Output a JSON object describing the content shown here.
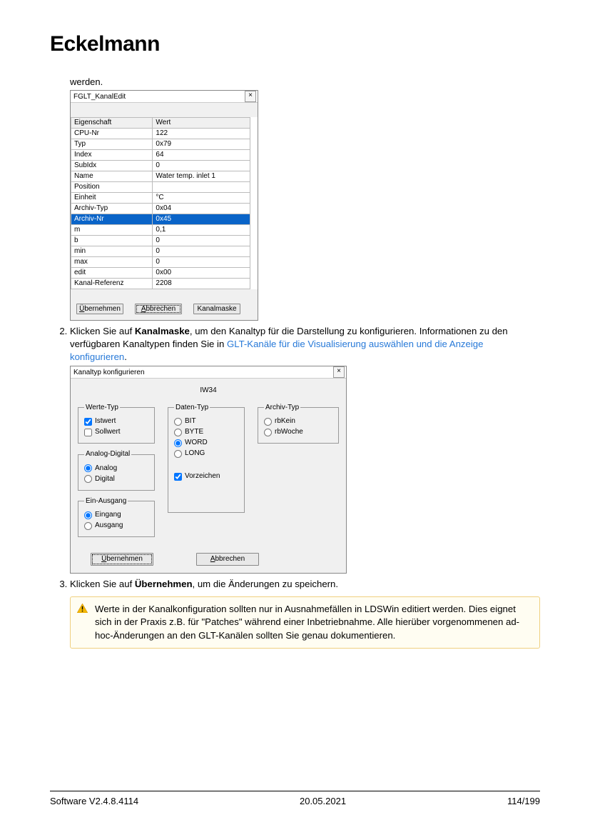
{
  "brand": "Eckelmann",
  "fragment": "werden.",
  "dialog1": {
    "title": "FGLT_KanalEdit",
    "head": {
      "k": "Eigenschaft",
      "v": "Wert"
    },
    "rows": [
      {
        "k": "CPU-Nr",
        "v": "122"
      },
      {
        "k": "Typ",
        "v": "0x79"
      },
      {
        "k": "Index",
        "v": "64"
      },
      {
        "k": "SubIdx",
        "v": "0"
      },
      {
        "k": "Name",
        "v": "Water temp. inlet 1"
      },
      {
        "k": "Position",
        "v": ""
      },
      {
        "k": "Einheit",
        "v": "°C"
      },
      {
        "k": "Archiv-Typ",
        "v": "0x04"
      },
      {
        "k": "Archiv-Nr",
        "v": "0x45"
      },
      {
        "k": "m",
        "v": "0,1"
      },
      {
        "k": "b",
        "v": "0"
      },
      {
        "k": "min",
        "v": "0"
      },
      {
        "k": "max",
        "v": "0"
      },
      {
        "k": "edit",
        "v": "0x00"
      },
      {
        "k": "Kanal-Referenz",
        "v": "2208"
      }
    ],
    "selected_index": 8,
    "btn_apply": "Übernehmen",
    "btn_cancel": "Abbrechen",
    "btn_mask": "Kanalmaske"
  },
  "step2": {
    "pre": "Klicken Sie auf ",
    "bold": "Kanalmaske",
    "mid": ", um den Kanaltyp für die Darstellung zu konfigurieren. Informationen zu den verfügbaren Kanaltypen finden Sie in ",
    "link": "GLT-Kanäle für die Visualisierung auswählen und die Anzeige konfigurieren",
    "post": "."
  },
  "dialog2": {
    "title": "Kanaltyp konfigurieren",
    "subtitle": "IW34",
    "werte": {
      "legend": "Werte-Typ",
      "istwert": "Istwert",
      "sollwert": "Sollwert"
    },
    "ad": {
      "legend": "Analog-Digital",
      "analog": "Analog",
      "digital": "Digital"
    },
    "ea": {
      "legend": "Ein-Ausgang",
      "ein": "Eingang",
      "aus": "Ausgang"
    },
    "daten": {
      "legend": "Daten-Typ",
      "bit": "BIT",
      "byte": "BYTE",
      "word": "WORD",
      "long": "LONG",
      "vorz": "Vorzeichen"
    },
    "archiv": {
      "legend": "Archiv-Typ",
      "kein": "rbKein",
      "woche": "rbWoche"
    },
    "btn_apply": "Übernehmen",
    "btn_cancel": "Abbrechen"
  },
  "step3": {
    "pre": "Klicken Sie auf ",
    "bold": "Übernehmen",
    "post": ", um die Änderungen zu speichern."
  },
  "warn": "Werte in der Kanalkonfiguration sollten nur in Ausnahmefällen in LDSWin editiert werden. Dies eignet sich in der Praxis z.B. für \"Patches\" während einer Inbetriebnahme. Alle hierüber vorgenommenen ad-hoc-Änderungen an den GLT-Kanälen sollten Sie genau dokumentieren.",
  "footer": {
    "left": "Software V2.4.8.4114",
    "center": "20.05.2021",
    "right": "114/199"
  }
}
